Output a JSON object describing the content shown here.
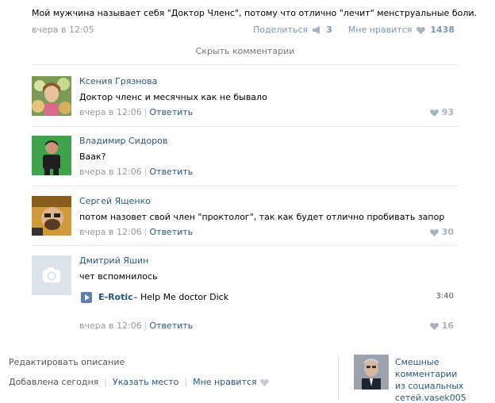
{
  "post": {
    "text": "Мой мужчина называет себя \"Доктор Членс\", потому что отлично \"лечит\" менструальные боли.",
    "date": "вчера в 12:05",
    "share_label": "Поделиться",
    "share_count": "3",
    "like_label": "Мне нравится",
    "like_count": "1438"
  },
  "hide_comments_label": "Скрыть комментарии",
  "comments": [
    {
      "author": "Ксения Грязнова",
      "text": "Доктор членс и месячных как не бывало",
      "date": "вчера в 12:06",
      "reply_label": "Ответить",
      "likes": "93"
    },
    {
      "author": "Владимир Сидоров",
      "text": "Ваак?",
      "date": "вчера в 12:06",
      "reply_label": "Ответить",
      "likes": ""
    },
    {
      "author": "Сергей Ященко",
      "text": "потом назовет свой член \"проктолог\", так как будет отлично пробивать запор",
      "date": "вчера в 12:06",
      "reply_label": "Ответить",
      "likes": "30"
    },
    {
      "author": "Дмитрий Яшин",
      "text": "чет вспомнилось",
      "date": "вчера в 12:06",
      "reply_label": "Ответить",
      "likes": "16",
      "audio": {
        "artist": "E-Rotic",
        "title": "– Help Me doctor Dick",
        "duration": "3:40"
      }
    }
  ],
  "footer": {
    "edit_label": "Редактировать описание",
    "added_label": "Добавлена сегодня",
    "place_label": "Указать место",
    "like_label": "Мне нравится",
    "group_name": "Смешные комментарии из социальных сетей.vasek005"
  },
  "colors": {
    "link": "#2b587a",
    "meta": "#999999",
    "divider": "#e4e8ed",
    "like_icon": "#a6b3c2"
  }
}
